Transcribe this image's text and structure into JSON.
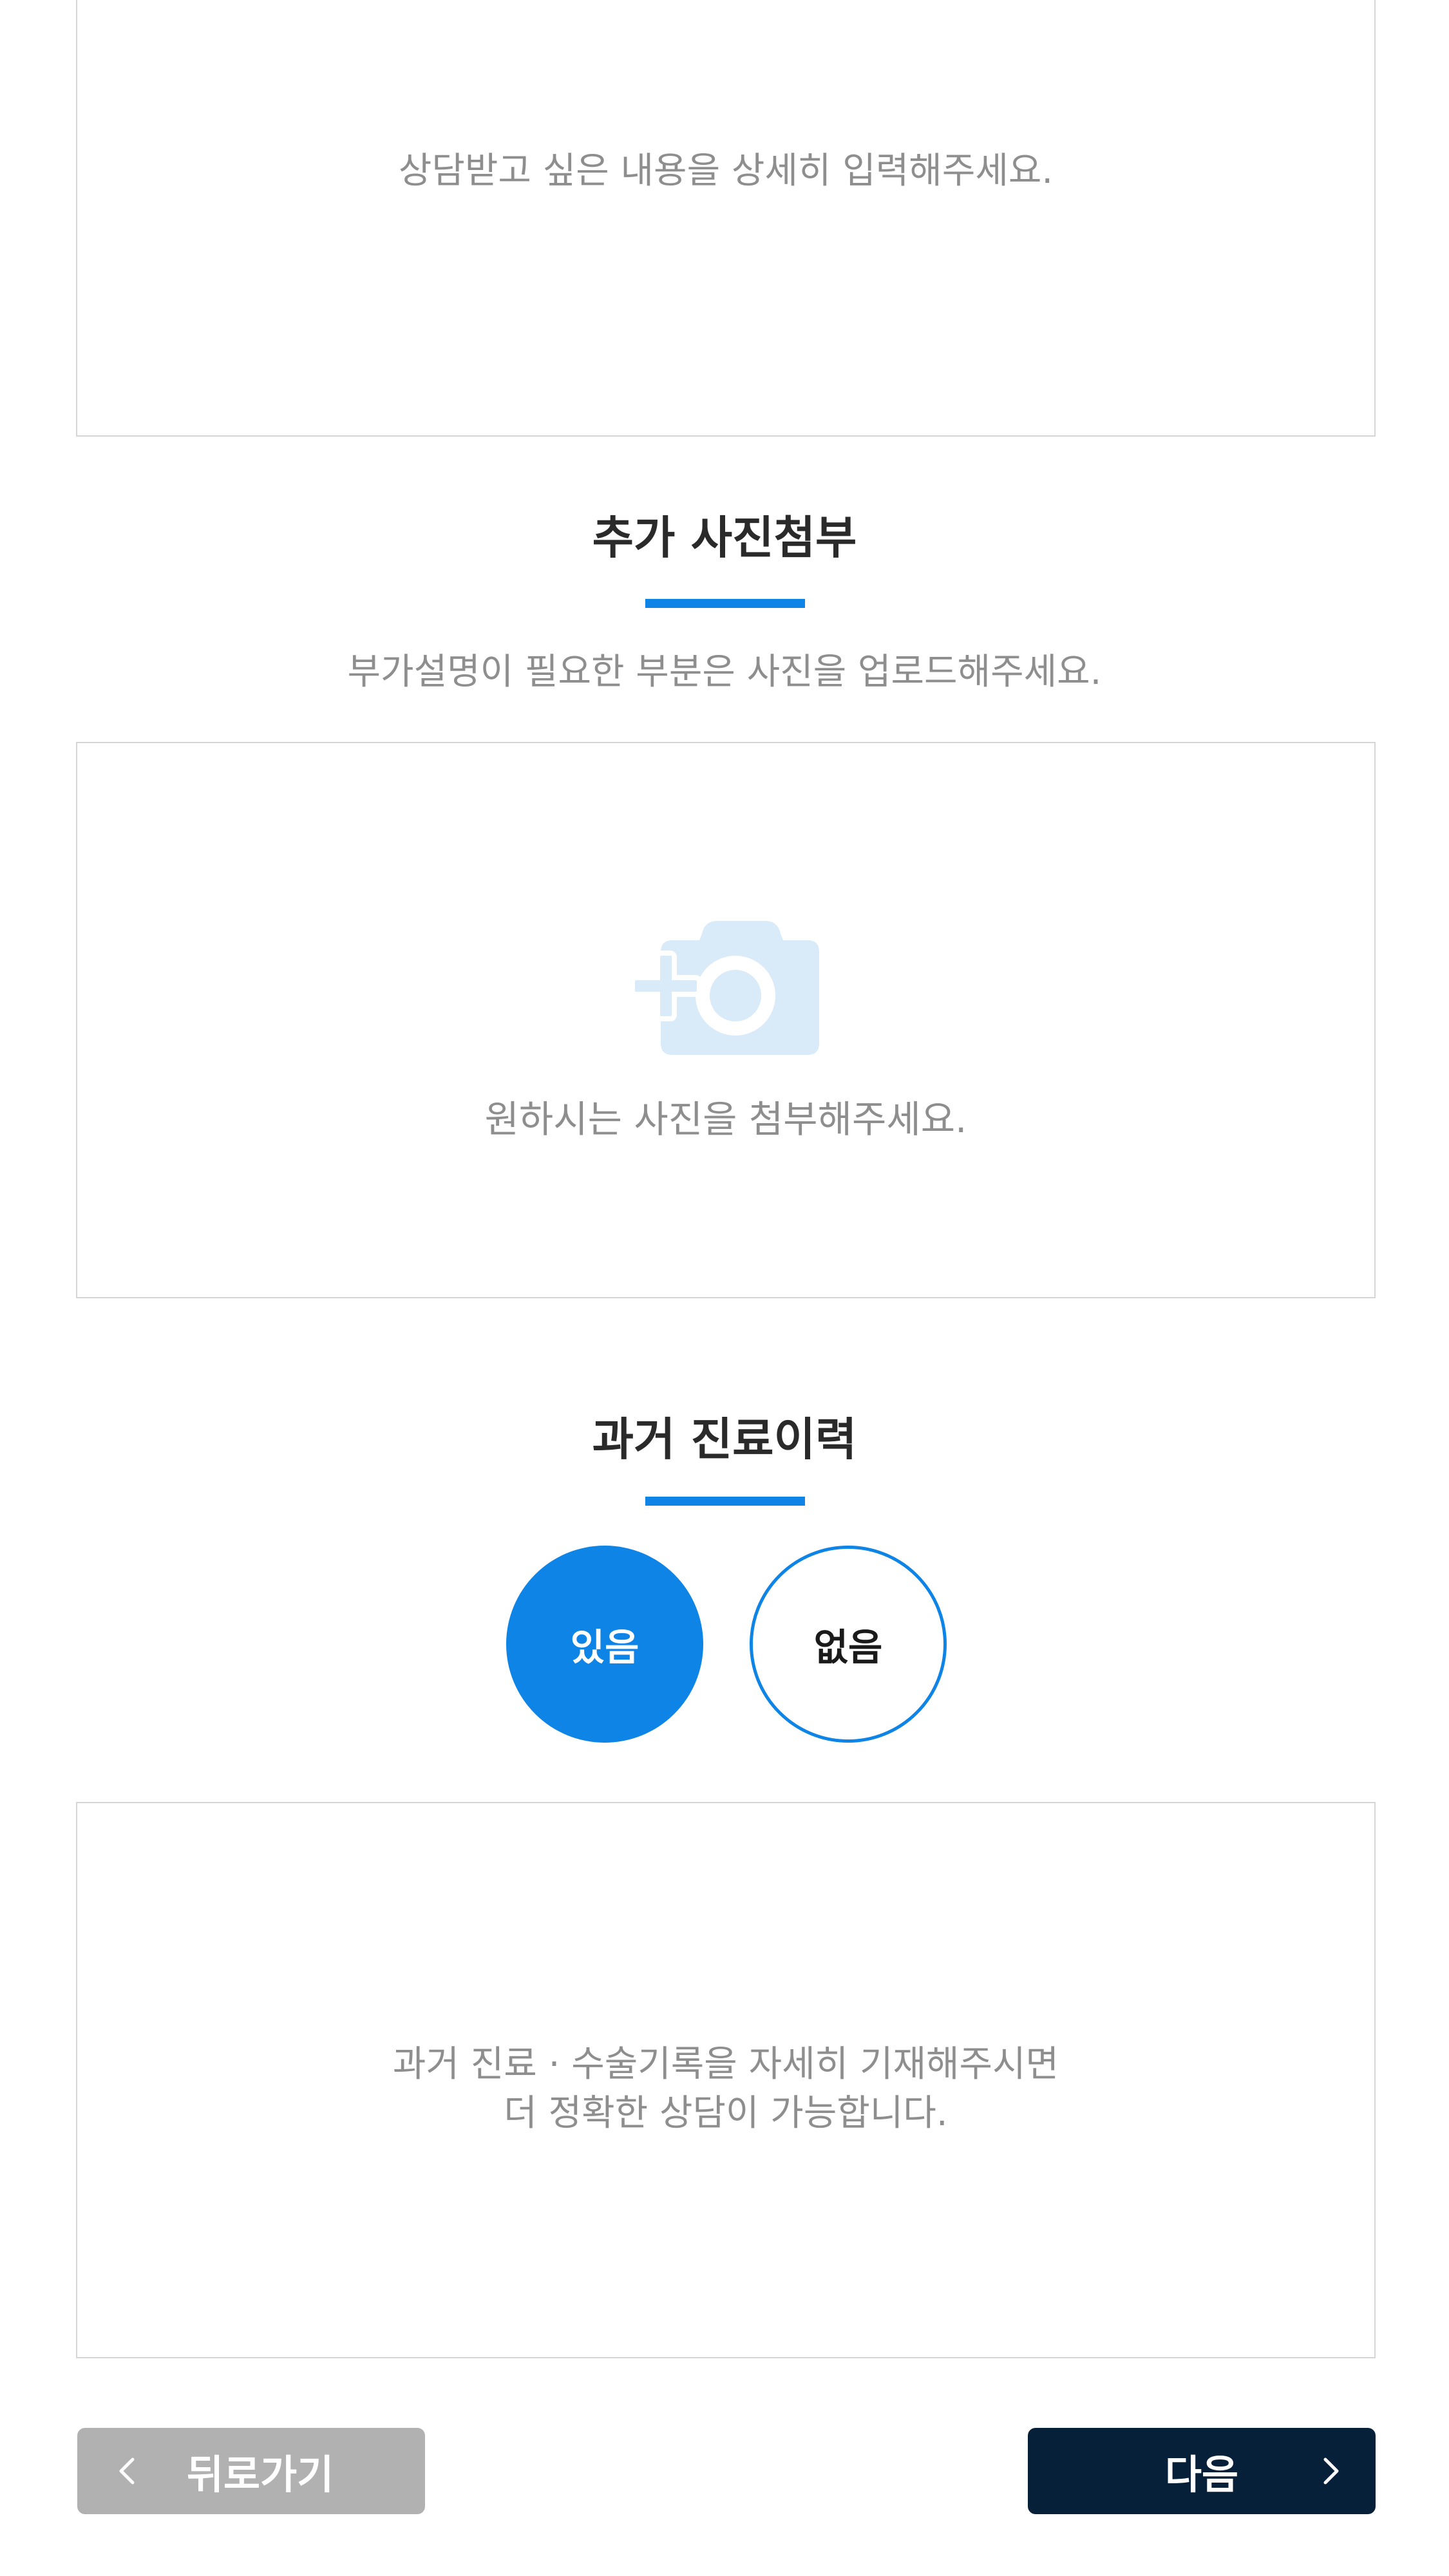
{
  "detail": {
    "placeholder": "상담받고 싶은 내용을 상세히 입력해주세요."
  },
  "photo_section": {
    "title": "추가 사진첨부",
    "subtitle": "부가설명이 필요한 부분은 사진을 업로드해주세요.",
    "upload_text": "원하시는 사진을 첨부해주세요.",
    "icon": "camera-plus-icon"
  },
  "history_section": {
    "title": "과거 진료이력",
    "options": [
      {
        "label": "있음",
        "selected": true
      },
      {
        "label": "없음",
        "selected": false
      }
    ],
    "placeholder": "과거 진료 · 수술기록을 자세히 기재해주시면\n더 정확한 상담이 가능합니다."
  },
  "buttons": {
    "back_label": "뒤로가기",
    "next_label": "다음"
  },
  "colors": {
    "accent": "#0d84e6",
    "next_bg": "#07203a",
    "back_bg": "#b1b1b1",
    "icon_tint": "#d9eaf9"
  }
}
